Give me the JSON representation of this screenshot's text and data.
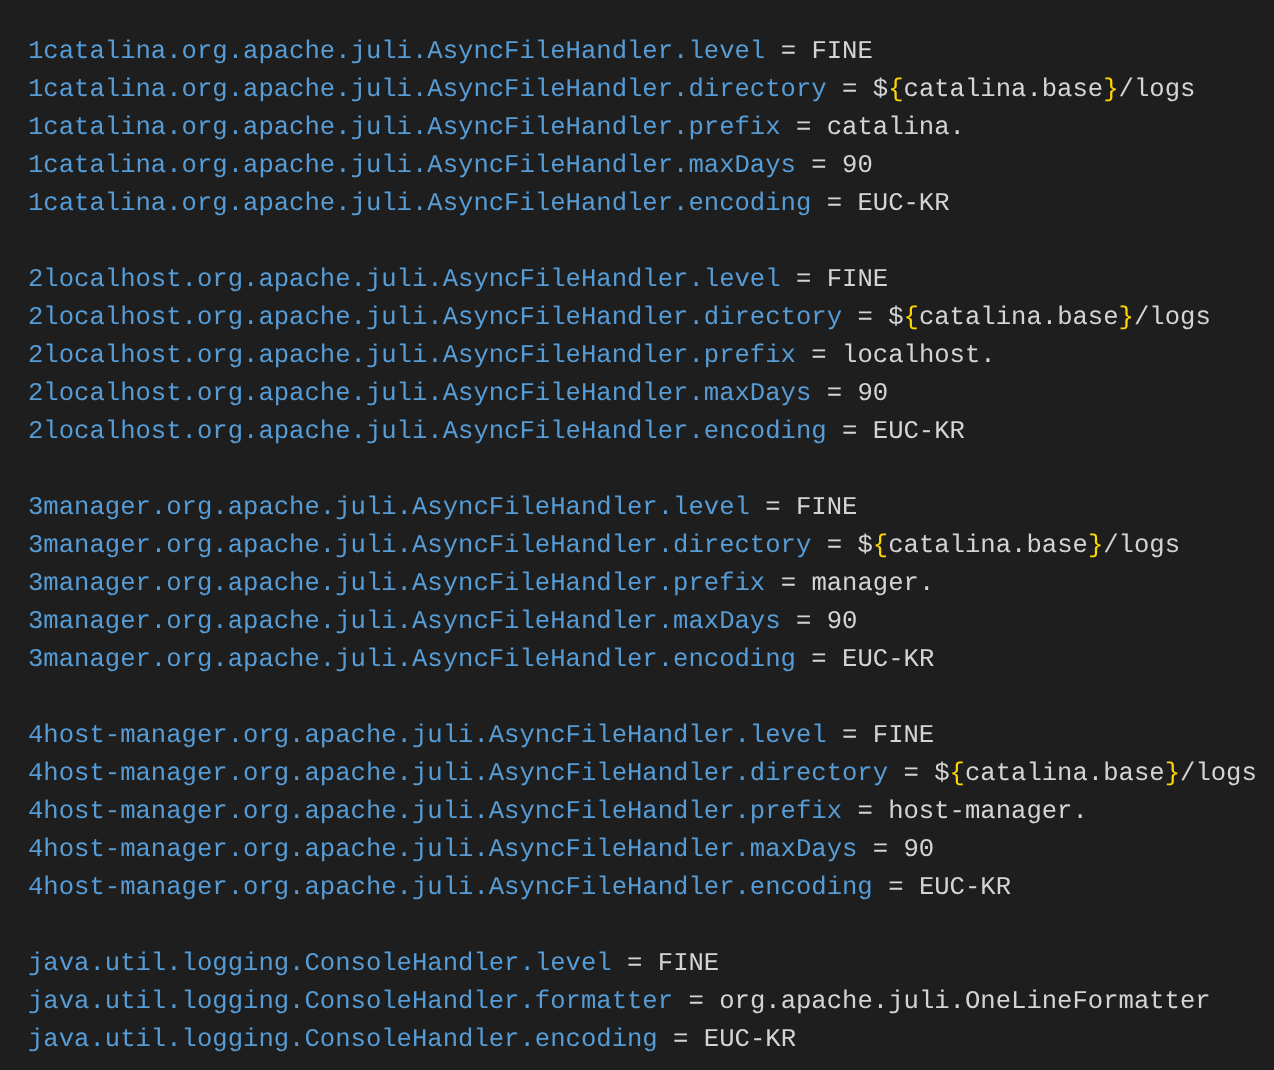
{
  "groups": [
    {
      "lines": [
        {
          "key": "1catalina.org.apache.juli.AsyncFileHandler.level",
          "value": [
            {
              "kind": "text",
              "text": "FINE"
            }
          ]
        },
        {
          "key": "1catalina.org.apache.juli.AsyncFileHandler.directory",
          "value": [
            {
              "kind": "text",
              "text": "$"
            },
            {
              "kind": "brace",
              "text": "{"
            },
            {
              "kind": "text",
              "text": "catalina.base"
            },
            {
              "kind": "brace",
              "text": "}"
            },
            {
              "kind": "text",
              "text": "/logs"
            }
          ]
        },
        {
          "key": "1catalina.org.apache.juli.AsyncFileHandler.prefix",
          "value": [
            {
              "kind": "text",
              "text": "catalina."
            }
          ]
        },
        {
          "key": "1catalina.org.apache.juli.AsyncFileHandler.maxDays",
          "value": [
            {
              "kind": "text",
              "text": "90"
            }
          ]
        },
        {
          "key": "1catalina.org.apache.juli.AsyncFileHandler.encoding",
          "value": [
            {
              "kind": "text",
              "text": "EUC-KR"
            }
          ]
        }
      ]
    },
    {
      "lines": [
        {
          "key": "2localhost.org.apache.juli.AsyncFileHandler.level",
          "value": [
            {
              "kind": "text",
              "text": "FINE"
            }
          ]
        },
        {
          "key": "2localhost.org.apache.juli.AsyncFileHandler.directory",
          "value": [
            {
              "kind": "text",
              "text": "$"
            },
            {
              "kind": "brace",
              "text": "{"
            },
            {
              "kind": "text",
              "text": "catalina.base"
            },
            {
              "kind": "brace",
              "text": "}"
            },
            {
              "kind": "text",
              "text": "/logs"
            }
          ]
        },
        {
          "key": "2localhost.org.apache.juli.AsyncFileHandler.prefix",
          "value": [
            {
              "kind": "text",
              "text": "localhost."
            }
          ]
        },
        {
          "key": "2localhost.org.apache.juli.AsyncFileHandler.maxDays",
          "value": [
            {
              "kind": "text",
              "text": "90"
            }
          ]
        },
        {
          "key": "2localhost.org.apache.juli.AsyncFileHandler.encoding",
          "value": [
            {
              "kind": "text",
              "text": "EUC-KR"
            }
          ]
        }
      ]
    },
    {
      "lines": [
        {
          "key": "3manager.org.apache.juli.AsyncFileHandler.level",
          "value": [
            {
              "kind": "text",
              "text": "FINE"
            }
          ]
        },
        {
          "key": "3manager.org.apache.juli.AsyncFileHandler.directory",
          "value": [
            {
              "kind": "text",
              "text": "$"
            },
            {
              "kind": "brace",
              "text": "{"
            },
            {
              "kind": "text",
              "text": "catalina.base"
            },
            {
              "kind": "brace",
              "text": "}"
            },
            {
              "kind": "text",
              "text": "/logs"
            }
          ]
        },
        {
          "key": "3manager.org.apache.juli.AsyncFileHandler.prefix",
          "value": [
            {
              "kind": "text",
              "text": "manager."
            }
          ]
        },
        {
          "key": "3manager.org.apache.juli.AsyncFileHandler.maxDays",
          "value": [
            {
              "kind": "text",
              "text": "90"
            }
          ]
        },
        {
          "key": "3manager.org.apache.juli.AsyncFileHandler.encoding",
          "value": [
            {
              "kind": "text",
              "text": "EUC-KR"
            }
          ]
        }
      ]
    },
    {
      "lines": [
        {
          "key": "4host-manager.org.apache.juli.AsyncFileHandler.level",
          "value": [
            {
              "kind": "text",
              "text": "FINE"
            }
          ]
        },
        {
          "key": "4host-manager.org.apache.juli.AsyncFileHandler.directory",
          "value": [
            {
              "kind": "text",
              "text": "$"
            },
            {
              "kind": "brace",
              "text": "{"
            },
            {
              "kind": "text",
              "text": "catalina.base"
            },
            {
              "kind": "brace",
              "text": "}"
            },
            {
              "kind": "text",
              "text": "/logs"
            }
          ]
        },
        {
          "key": "4host-manager.org.apache.juli.AsyncFileHandler.prefix",
          "value": [
            {
              "kind": "text",
              "text": "host-manager."
            }
          ]
        },
        {
          "key": "4host-manager.org.apache.juli.AsyncFileHandler.maxDays",
          "value": [
            {
              "kind": "text",
              "text": "90"
            }
          ]
        },
        {
          "key": "4host-manager.org.apache.juli.AsyncFileHandler.encoding",
          "value": [
            {
              "kind": "text",
              "text": "EUC-KR"
            }
          ]
        }
      ]
    },
    {
      "lines": [
        {
          "key": "java.util.logging.ConsoleHandler.level",
          "value": [
            {
              "kind": "text",
              "text": "FINE"
            }
          ]
        },
        {
          "key": "java.util.logging.ConsoleHandler.formatter",
          "value": [
            {
              "kind": "text",
              "text": "org.apache.juli.OneLineFormatter"
            }
          ]
        },
        {
          "key": "java.util.logging.ConsoleHandler.encoding",
          "value": [
            {
              "kind": "text",
              "text": "EUC-KR"
            }
          ]
        }
      ]
    }
  ],
  "separator": "="
}
